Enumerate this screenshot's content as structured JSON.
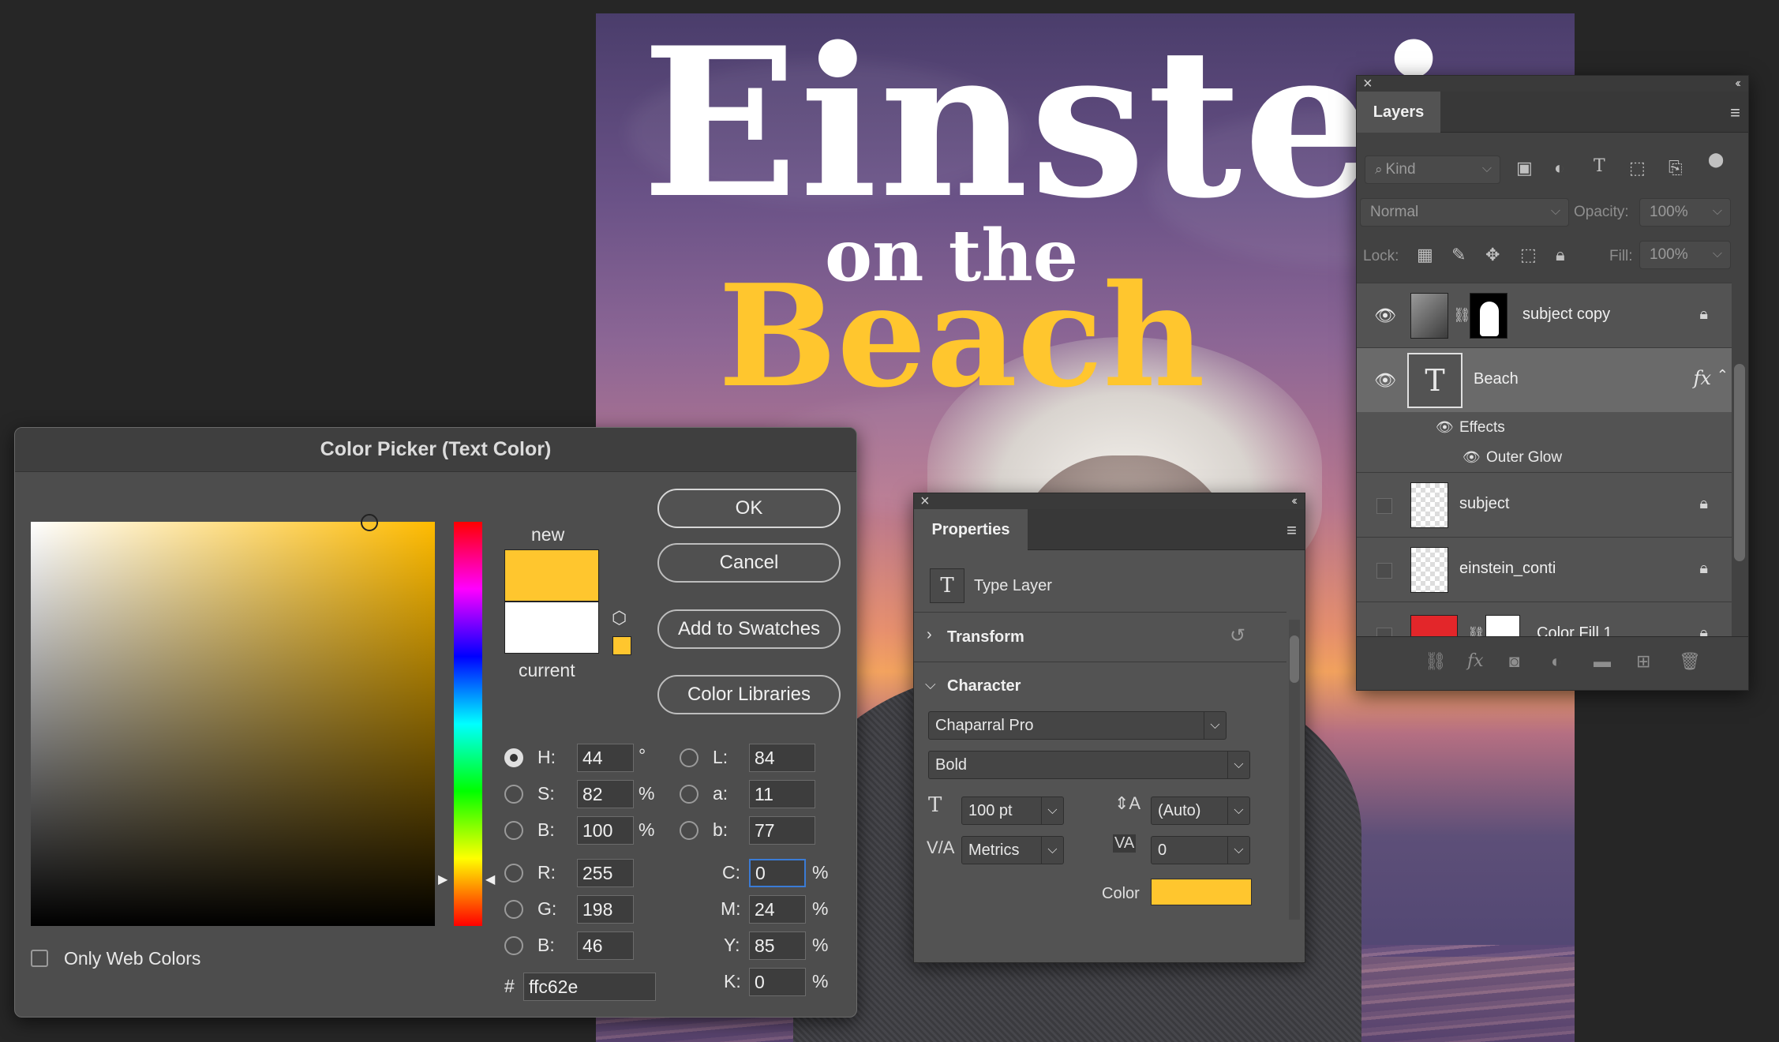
{
  "canvas": {
    "headline_line1": "Einstei",
    "headline_line2": "on the",
    "headline_line3": "Beach"
  },
  "layers_panel": {
    "tab": "Layers",
    "filter_kind": "Kind",
    "blend_mode": "Normal",
    "opacity_label": "Opacity:",
    "opacity_value": "100%",
    "lock_label": "Lock:",
    "fill_label": "Fill:",
    "fill_value": "100%",
    "layers": [
      {
        "name": "subject copy",
        "visible": true,
        "locked": true
      },
      {
        "name": "Beach",
        "visible": true,
        "selected": true,
        "fx": "fx"
      },
      {
        "name": "subject",
        "visible": false,
        "locked": true
      },
      {
        "name": "einstein_conti",
        "visible": false,
        "locked": true
      },
      {
        "name": "Color Fill 1",
        "visible": false,
        "locked": true
      }
    ],
    "effects_label": "Effects",
    "effect_outer_glow": "Outer Glow"
  },
  "properties_panel": {
    "tab": "Properties",
    "layer_type": "Type Layer",
    "section_transform": "Transform",
    "section_character": "Character",
    "font_family": "Chaparral Pro",
    "font_style": "Bold",
    "font_size": "100 pt",
    "leading": "(Auto)",
    "kerning": "Metrics",
    "tracking": "0",
    "color_label": "Color",
    "color_value": "#ffc62e"
  },
  "color_picker": {
    "title": "Color Picker (Text Color)",
    "ok": "OK",
    "cancel": "Cancel",
    "add_to_swatches": "Add to Swatches",
    "color_libraries": "Color Libraries",
    "new_label": "new",
    "current_label": "current",
    "new_color": "#ffc62e",
    "current_color": "#ffffff",
    "only_web_colors": "Only Web Colors",
    "H": "44",
    "S": "82",
    "B": "100",
    "R": "255",
    "G": "198",
    "B2": "46",
    "L": "84",
    "a": "11",
    "b": "77",
    "C": "0",
    "M": "24",
    "Y": "85",
    "K": "0",
    "hex": "ffc62e",
    "labels": {
      "H": "H:",
      "S": "S:",
      "B": "B:",
      "R": "R:",
      "G": "G:",
      "B2": "B:",
      "L": "L:",
      "a": "a:",
      "b": "b:",
      "C": "C:",
      "M": "M:",
      "Y": "Y:",
      "K": "K:",
      "hash": "#",
      "deg": "°",
      "pct": "%"
    }
  }
}
